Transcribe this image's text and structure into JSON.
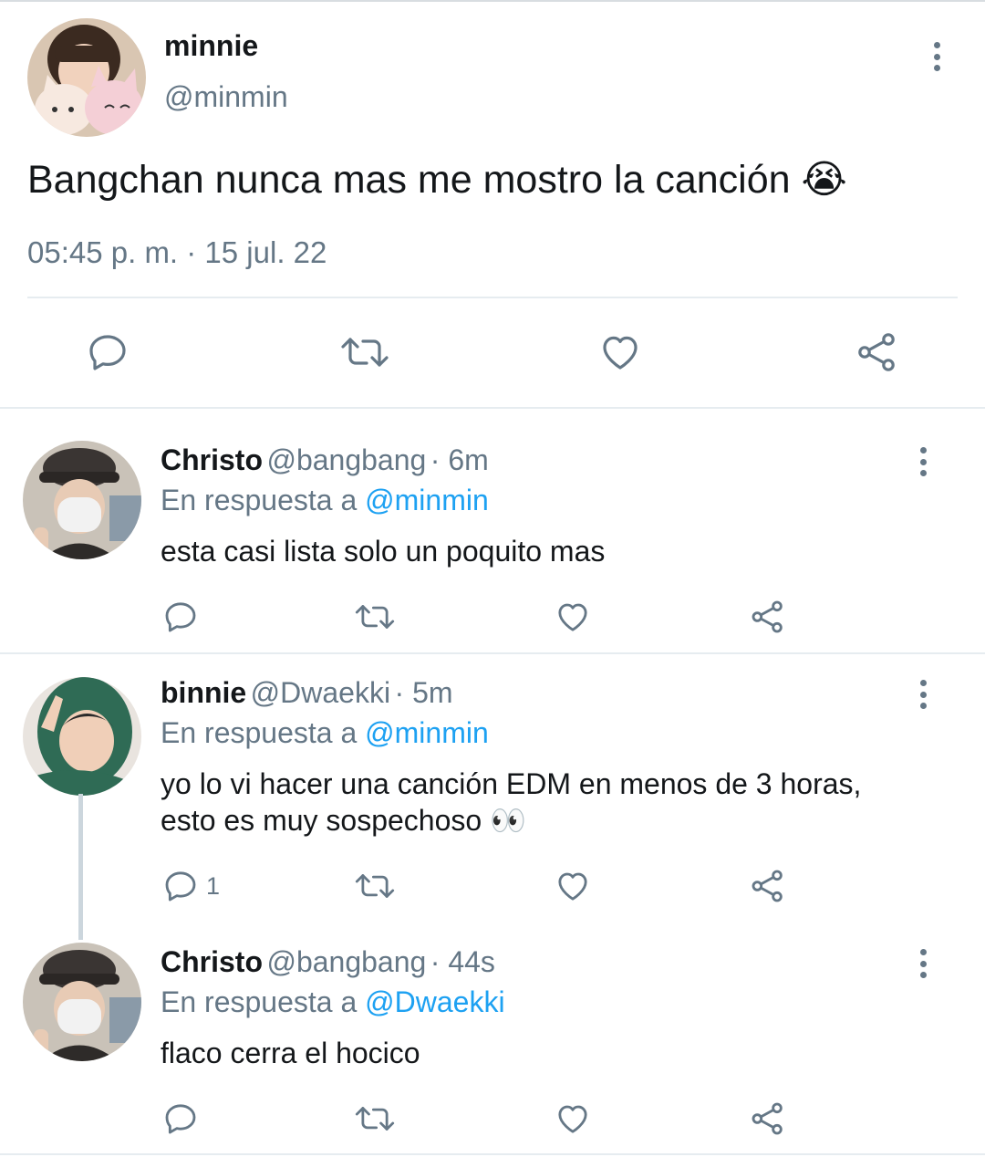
{
  "main_tweet": {
    "name": "minnie",
    "handle": "@minmin",
    "text": "Bangchan nunca mas me mostro la canción",
    "emoji": "😭",
    "timestamp": "05:45 p. m. · 15 jul. 22"
  },
  "replies": [
    {
      "name": "Christo",
      "handle": "@bangbang",
      "time": "· 6m",
      "reply_prefix": "En respuesta a",
      "reply_to": "@minmin",
      "lines": [
        "esta casi lista solo un poquito mas"
      ],
      "reply_count": ""
    },
    {
      "name": "binnie",
      "handle": "@Dwaekki",
      "time": "· 5m",
      "reply_prefix": "En respuesta a",
      "reply_to": "@minmin",
      "lines": [
        "yo lo vi hacer una canción EDM en menos de 3 horas,",
        "esto es muy sospechoso 👀"
      ],
      "reply_count": "1"
    },
    {
      "name": "Christo",
      "handle": "@bangbang",
      "time": "· 44s",
      "reply_prefix": "En respuesta a",
      "reply_to": "@Dwaekki",
      "lines": [
        "flaco cerra el hocico"
      ],
      "reply_count": ""
    }
  ],
  "colors": {
    "text": "#14171a",
    "secondary": "#657786",
    "link": "#1da1f2",
    "divider": "#e6ecf0"
  },
  "icons": [
    "reply-icon",
    "retweet-icon",
    "like-icon",
    "share-icon",
    "more-options-icon"
  ]
}
